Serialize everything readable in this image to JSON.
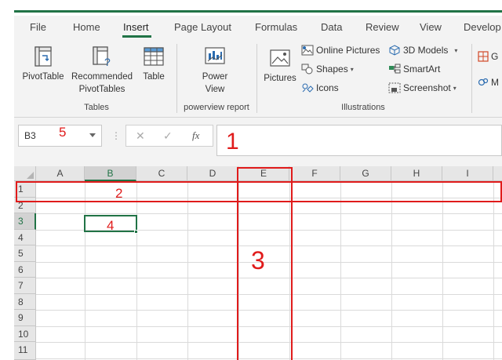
{
  "menu_tabs": [
    "File",
    "Home",
    "Insert",
    "Page Layout",
    "Formulas",
    "Data",
    "Review",
    "View",
    "Develop"
  ],
  "active_tab": "Insert",
  "ribbon": {
    "tables": {
      "pivottable": "PivotTable",
      "recommended_line1": "Recommended",
      "recommended_line2": "PivotTables",
      "table": "Table",
      "group_label": "Tables"
    },
    "powerview": {
      "label_line1": "Power",
      "label_line2": "View",
      "group_label": "powerview report"
    },
    "illustrations": {
      "pictures": "Pictures",
      "online_pictures": "Online Pictures",
      "shapes": "Shapes",
      "icons": "Icons",
      "models_3d": "3D Models",
      "smartart": "SmartArt",
      "screenshot": "Screenshot",
      "group_label": "Illustrations"
    },
    "overflow": {
      "item1": "G",
      "item2": "M"
    }
  },
  "formula_bar": {
    "name_box": "B3",
    "cancel_symbol": "✕",
    "enter_symbol": "✓",
    "fx_symbol": "fx",
    "value": ""
  },
  "grid": {
    "columns": [
      "A",
      "B",
      "C",
      "D",
      "E",
      "F",
      "G",
      "H",
      "I"
    ],
    "rows": [
      "1",
      "2",
      "3",
      "4",
      "5",
      "6",
      "7",
      "8",
      "9",
      "10",
      "11"
    ],
    "selected_column": "B",
    "selected_row": "3"
  },
  "annotations": {
    "formula_bar": "1",
    "row_1": "2",
    "column_e": "3",
    "active_cell": "4",
    "name_box": "5"
  },
  "colors": {
    "excel_green": "#217346",
    "annotation_red": "#e01b1b"
  }
}
